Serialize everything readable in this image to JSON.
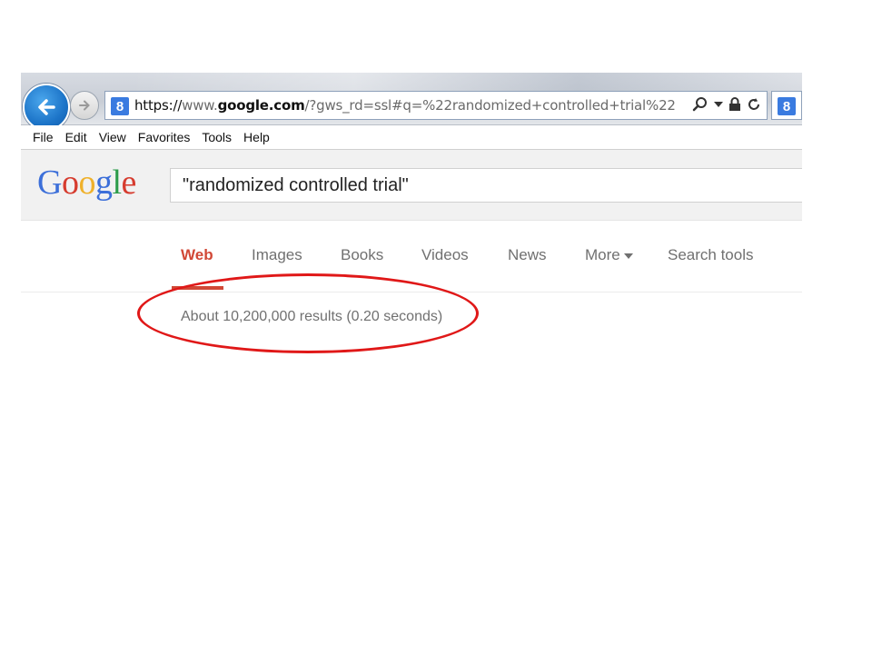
{
  "browser": {
    "url_scheme": "https://",
    "url_domain_pre": "www.",
    "url_domain": "google.com",
    "url_path": "/?gws_rd=ssl#q=%22randomized+controlled+trial%22",
    "favicon_letter": "8"
  },
  "menu": [
    "File",
    "Edit",
    "View",
    "Favorites",
    "Tools",
    "Help"
  ],
  "google": {
    "logo_letters": [
      "G",
      "o",
      "o",
      "g",
      "l",
      "e"
    ],
    "search_value": "\"randomized controlled trial\""
  },
  "tabs": {
    "web": "Web",
    "images": "Images",
    "books": "Books",
    "videos": "Videos",
    "news": "News",
    "more": "More",
    "search_tools": "Search tools"
  },
  "results": {
    "count_text": "About 10,200,000 results (0.20 seconds)"
  },
  "colors": {
    "active_tab": "#d14836",
    "annotation": "#e01818",
    "logo_blue": "#3c6fd9",
    "logo_red": "#d63c2f",
    "logo_yellow": "#efb12b",
    "logo_green": "#2c9c4a"
  }
}
